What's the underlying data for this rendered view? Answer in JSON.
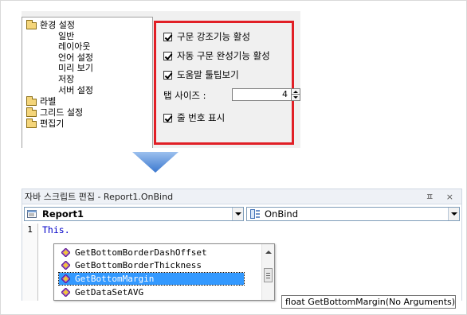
{
  "options_dialog": {
    "tree": {
      "root": "환경 설정",
      "children": [
        "일반",
        "레이아웃",
        "언어 설정",
        "미리 보기",
        "저장",
        "서버 설정"
      ],
      "siblings": [
        "라벨",
        "그리드 설정",
        "편집기"
      ]
    },
    "checks": {
      "syntax_highlight": "구문 강조기능 활성",
      "auto_complete": "자동 구문 완성기능 활성",
      "help_tooltip": "도움말 툴팁보기",
      "line_numbers": "줄 번호 표시"
    },
    "tab_size": {
      "label": "탭 사이즈 :",
      "value": "4"
    }
  },
  "editor": {
    "title": "자바 스크립트 편집 - Report1.OnBind",
    "title_buttons": "ㅍ ×",
    "object_combo": "Report1",
    "event_combo": "OnBind",
    "line_number": "1",
    "code": "This.",
    "autocomplete_items": [
      "GetBottomBorderDashOffset",
      "GetBottomBorderThickness",
      "GetBottomMargin",
      "GetDataSetAVG"
    ],
    "selected_index": 2,
    "tooltip": "float GetBottomMargin(No Arguments)"
  },
  "colors": {
    "highlight_border": "#e11f26",
    "selection": "#3399ff",
    "arrow": "#4f8ad8"
  }
}
